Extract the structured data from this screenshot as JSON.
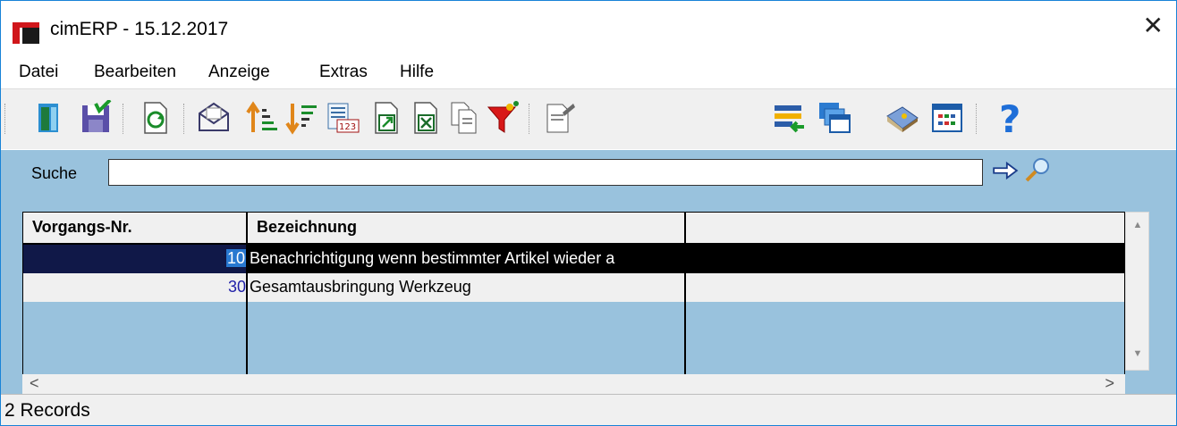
{
  "window": {
    "title": "cimERP - 15.12.2017"
  },
  "menu": [
    "Datei",
    "Bearbeiten",
    "Anzeige",
    "Extras",
    "Hilfe"
  ],
  "toolbar": {
    "icons": [
      "exit-icon",
      "save-icon",
      "refresh-icon",
      "mail-icon",
      "sort-ascending-icon",
      "sort-descending-icon",
      "calendar-123-icon",
      "export-icon",
      "excel-export-icon",
      "copy-icon",
      "filter-icon",
      "edit-icon",
      "list-import-icon",
      "windows-icon",
      "book-icon",
      "columns-icon",
      "help-icon"
    ]
  },
  "search": {
    "label": "Suche",
    "value": ""
  },
  "table": {
    "columns": [
      "Vorgangs-Nr.",
      "Bezeichnung",
      ""
    ],
    "rows": [
      {
        "nr": "10",
        "bezeichnung": "Benachrichtigung wenn bestimmter Artikel wieder a",
        "extra": "",
        "selected": true
      },
      {
        "nr": "30",
        "bezeichnung": "Gesamtausbringung Werkzeug",
        "extra": "",
        "selected": false
      }
    ]
  },
  "status": {
    "text": "2 Records"
  },
  "colors": {
    "grid_bg": "#99c2dd",
    "selection": "#000000",
    "accent": "#d0161b"
  }
}
